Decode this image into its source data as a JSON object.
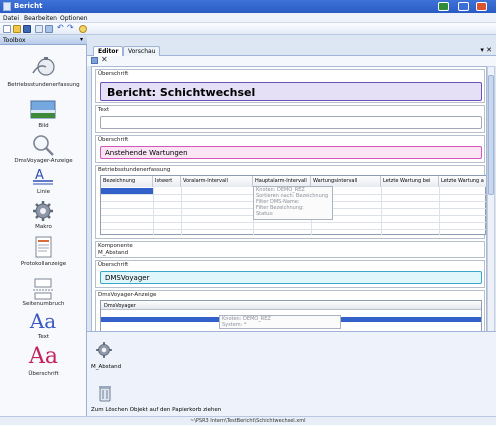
{
  "window": {
    "title": "Bericht"
  },
  "menu": {
    "items": [
      "Datei",
      "Bearbeiten",
      "Optionen"
    ]
  },
  "toolbox": {
    "title": "Toolbox",
    "pin": "▾",
    "items": [
      {
        "label": "Betriebsstundenerfassung",
        "icon": "stopwatch-icon"
      },
      {
        "label": "Bild",
        "icon": "picture-icon"
      },
      {
        "label": "DmsVoyager-Anzeige",
        "icon": "magnifier-icon"
      },
      {
        "label": "Linie",
        "icon": "line-tool-icon"
      },
      {
        "label": "Makro",
        "icon": "gear-icon"
      },
      {
        "label": "Protokollanzeige",
        "icon": "document-icon"
      },
      {
        "label": "Seitenumbruch",
        "icon": "page-break-icon"
      },
      {
        "label": "Text",
        "icon": "text-icon"
      },
      {
        "label": "Überschrift",
        "icon": "heading-icon"
      }
    ],
    "glyph_text": "Aa"
  },
  "tabs": [
    {
      "label": "Editor",
      "active": true
    },
    {
      "label": "Vorschau",
      "active": false
    }
  ],
  "doc_close": "▾ ✕",
  "edit_delete": "✕",
  "report": {
    "sections": [
      {
        "caption": "Überschrift",
        "value": "Bericht: Schichtwechsel"
      },
      {
        "caption": "Text",
        "value": ""
      },
      {
        "caption": "Überschrift",
        "value": "Anstehende Wartungen"
      },
      {
        "caption": "Betriebsstundenerfassung"
      },
      {
        "caption": "Komponente",
        "value": "M_Abstand"
      },
      {
        "caption": "Überschrift",
        "value": "DMSVoyager"
      },
      {
        "caption": "DmsVoyager-Anzeige",
        "subcaption": "DmsVoyager"
      }
    ],
    "table_headers": [
      "Bezeichnung",
      "Istwert",
      "Voralarm-Intervall",
      "Hauptalarm-Intervall",
      "Wartungsintervall",
      "Letzte Wartung bei",
      "Letzte Wartung a"
    ],
    "context_menu": [
      "Knoten: DEMO_REZ",
      "Sortieren nach: Bezeichnung",
      "Filter DMS-Name:",
      "Filter Bezeichnung:",
      "Status:"
    ],
    "dms_menu": [
      "Knoten: DEMO_REZ",
      "System: *"
    ]
  },
  "bottom": {
    "component_label": "M_Abstand",
    "trash_hint": "Zum Löschen Objekt auf den Papierkorb ziehen"
  },
  "status": {
    "text": "~\\PSR3 Intern\\TestBericht\\Schichtwechsel.xml"
  },
  "colors": {
    "heading_fill": "#e6e0f7",
    "heading_border": "#6a52b8",
    "pink_fill": "#fbe5f5",
    "pink_border": "#d356b8",
    "cyan_fill": "#dff6fb",
    "cyan_border": "#39a8c8",
    "selection": "#3161c9",
    "accent": "#2a5bc4"
  }
}
